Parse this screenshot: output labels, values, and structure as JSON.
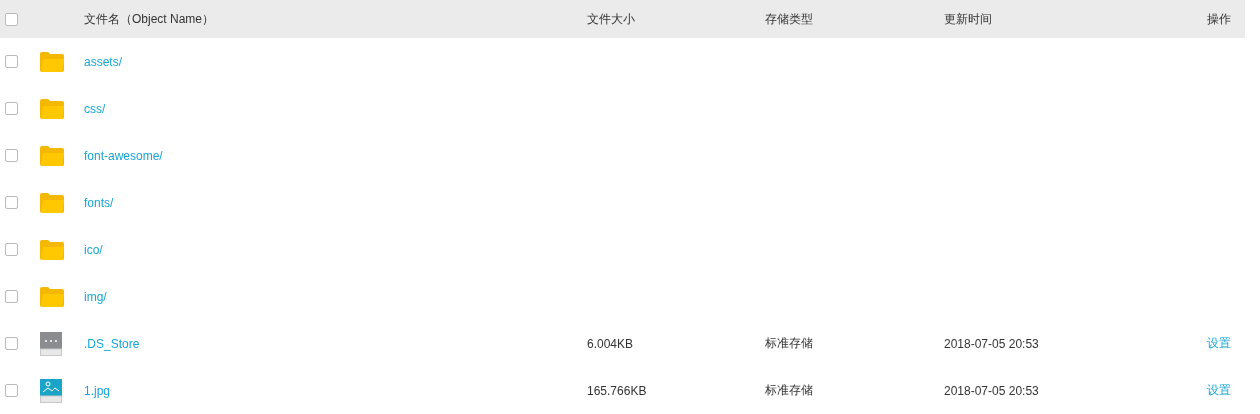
{
  "table": {
    "header_checkbox": {
      "checked": false
    },
    "columns": [
      "文件名（Object Name）",
      "文件大小",
      "存储类型",
      "更新时间",
      "操作"
    ],
    "rows": [
      {
        "kind": "folder",
        "checked": false,
        "name": "assets/"
      },
      {
        "kind": "folder",
        "checked": false,
        "name": "css/"
      },
      {
        "kind": "folder",
        "checked": false,
        "name": "font-awesome/"
      },
      {
        "kind": "folder",
        "checked": false,
        "name": "fonts/"
      },
      {
        "kind": "folder",
        "checked": false,
        "name": "ico/"
      },
      {
        "kind": "folder",
        "checked": false,
        "name": "img/"
      },
      {
        "kind": "file",
        "checked": false,
        "name": ".DS_Store",
        "size": "6.004KB",
        "storage": "标准存储",
        "updated": "2018-07-05 20:53",
        "action": "设置"
      },
      {
        "kind": "image",
        "checked": false,
        "name": "1.jpg",
        "size": "165.766KB",
        "storage": "标准存储",
        "updated": "2018-07-05 20:53",
        "action": "设置"
      }
    ]
  }
}
